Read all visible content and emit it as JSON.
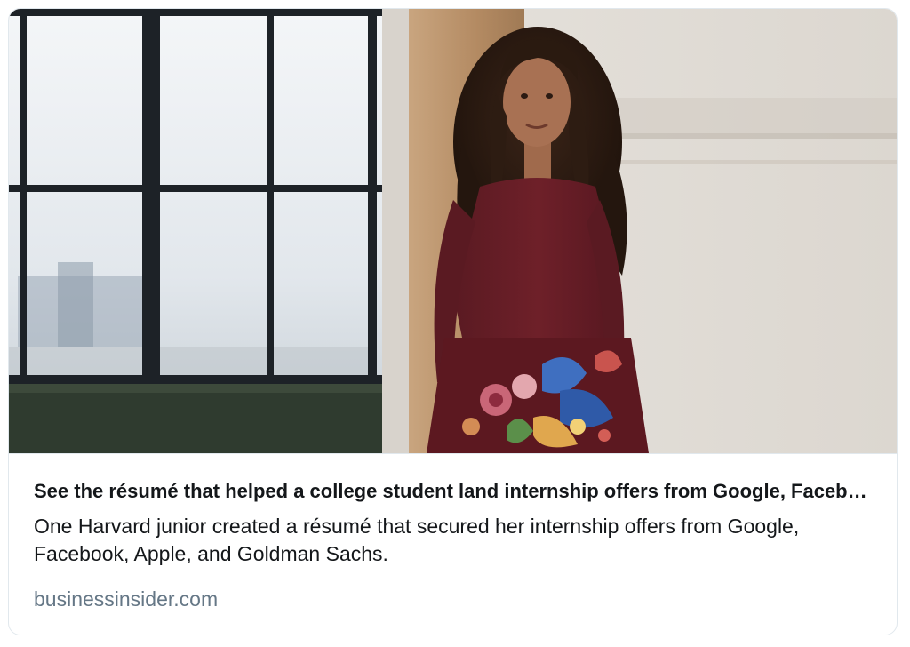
{
  "card": {
    "image_alt": "Woman with long curly hair in a burgundy floral dress standing by a window",
    "title": "See the résumé that helped a college student land internship offers from Google, Facebook, Apple, and Goldman Sachs",
    "description": "One Harvard junior created a résumé that secured her internship offers from Google, Facebook, Apple, and Goldman Sachs.",
    "domain": "businessinsider.com"
  },
  "colors": {
    "title": "#14171a",
    "domain": "#657786",
    "border": "#e1e8ed"
  }
}
